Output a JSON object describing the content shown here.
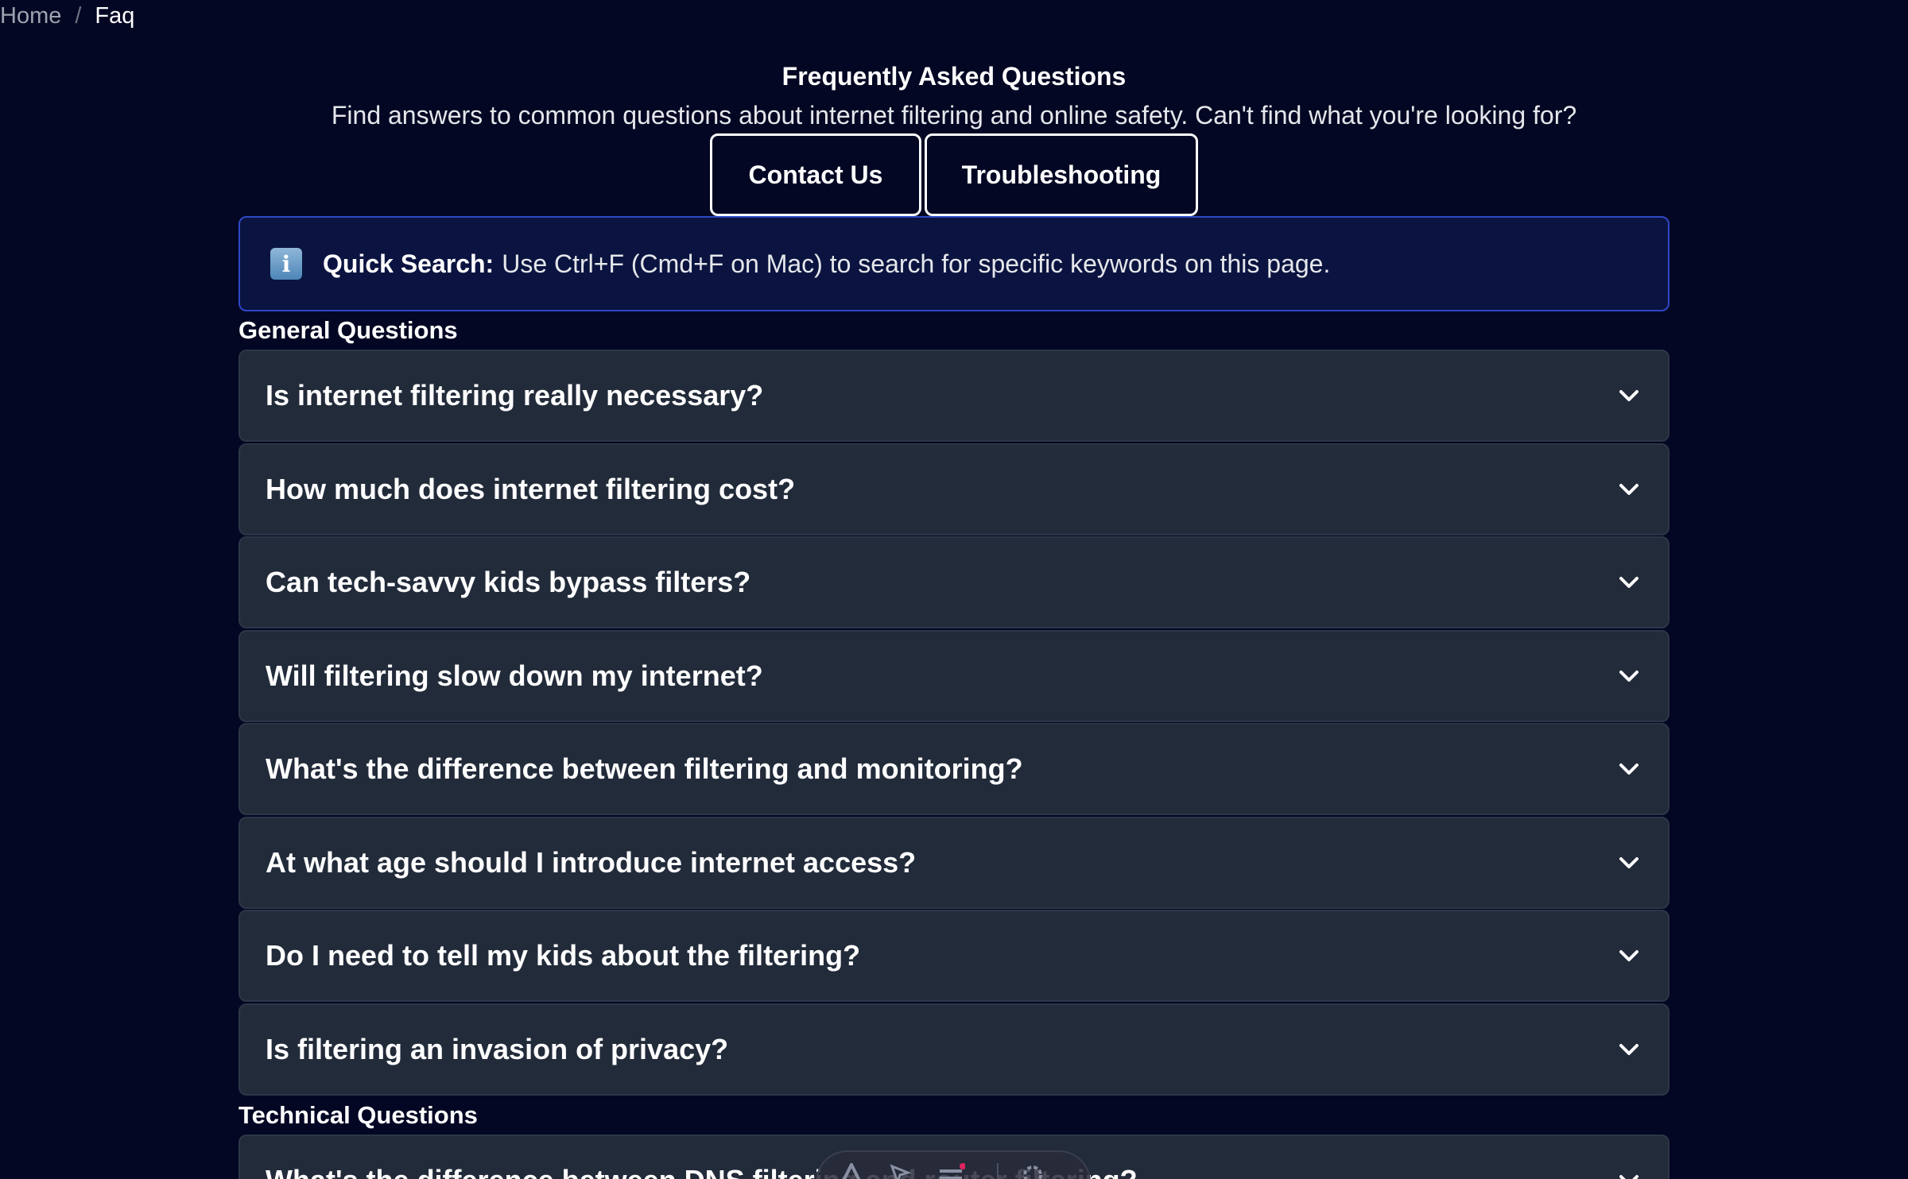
{
  "breadcrumb": {
    "home": "Home",
    "separator": "/",
    "current": "Faq"
  },
  "header": {
    "title": "Frequently Asked Questions",
    "subtitle": "Find answers to common questions about internet filtering and online safety. Can't find what you're looking for?"
  },
  "actions": {
    "contact_label": "Contact Us",
    "troubleshooting_label": "Troubleshooting"
  },
  "notice": {
    "icon": "info-icon",
    "icon_glyph": "i",
    "label": "Quick Search:",
    "text": "Use Ctrl+F (Cmd+F on Mac) to search for specific keywords on this page."
  },
  "sections": [
    {
      "heading": "General Questions",
      "items": [
        "Is internet filtering really necessary?",
        "How much does internet filtering cost?",
        "Can tech-savvy kids bypass filters?",
        "Will filtering slow down my internet?",
        "What's the difference between filtering and monitoring?",
        "At what age should I introduce internet access?",
        "Do I need to tell my kids about the filtering?",
        "Is filtering an invasion of privacy?"
      ]
    },
    {
      "heading": "Technical Questions",
      "items": [
        "What's the difference between DNS filtering and router filtering?"
      ]
    }
  ],
  "colors": {
    "background": "#030723",
    "card": "#222b3a",
    "notice_border": "#2f47c6",
    "notice_bg": "#0b1440"
  }
}
